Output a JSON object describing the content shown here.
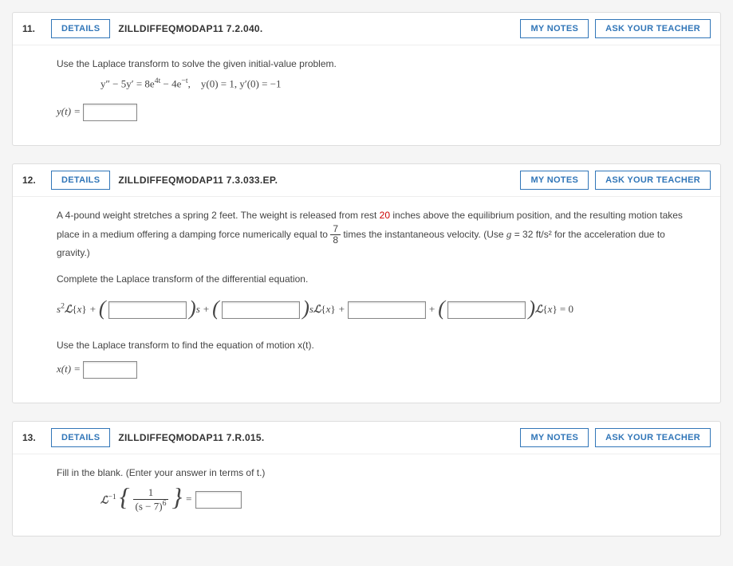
{
  "buttons": {
    "details": "DETAILS",
    "mynotes": "MY NOTES",
    "askteacher": "ASK YOUR TEACHER"
  },
  "q11": {
    "num": "11.",
    "source": "ZILLDIFFEQMODAP11 7.2.040.",
    "prompt": "Use the Laplace transform to solve the given initial-value problem.",
    "equation": "y″ − 5y′ = 8e⁴ᵗ − 4e⁻ᵗ,    y(0) = 1, y′(0) = −1",
    "answer_label": "y(t) ="
  },
  "q12": {
    "num": "12.",
    "source": "ZILLDIFFEQMODAP11 7.3.033.EP.",
    "text_a": "A 4-pound weight stretches a spring 2 feet. The weight is released from rest ",
    "text_a_red": "20",
    "text_b": " inches above the equilibrium position, and the resulting motion takes place in a medium offering a damping force numerically equal to ",
    "frac_num": "7",
    "frac_den": "8",
    "text_c": " times the instantaneous velocity. (Use ",
    "text_c_ital": "g",
    "text_c2": " = 32 ft/s² for the acceleration due to gravity.)",
    "prompt2": "Complete the Laplace transform of the differential equation.",
    "eq_part1": "s²ℒ{x} + ",
    "eq_part_s": "s",
    "eq_part_plus": " + ",
    "eq_part_sLx": "sℒ{x}",
    "eq_part_Lx": "ℒ{x} = 0",
    "prompt3": "Use the Laplace transform to find the equation of motion x(t).",
    "answer_label": "x(t) ="
  },
  "q13": {
    "num": "13.",
    "source": "ZILLDIFFEQMODAP11 7.R.015.",
    "prompt": "Fill in the blank. (Enter your answer in terms of t.)",
    "script_L": "ℒ",
    "sup_neg1": "−1",
    "frac_num": "1",
    "frac_den": "(s − 7)⁶",
    "equals": "="
  }
}
